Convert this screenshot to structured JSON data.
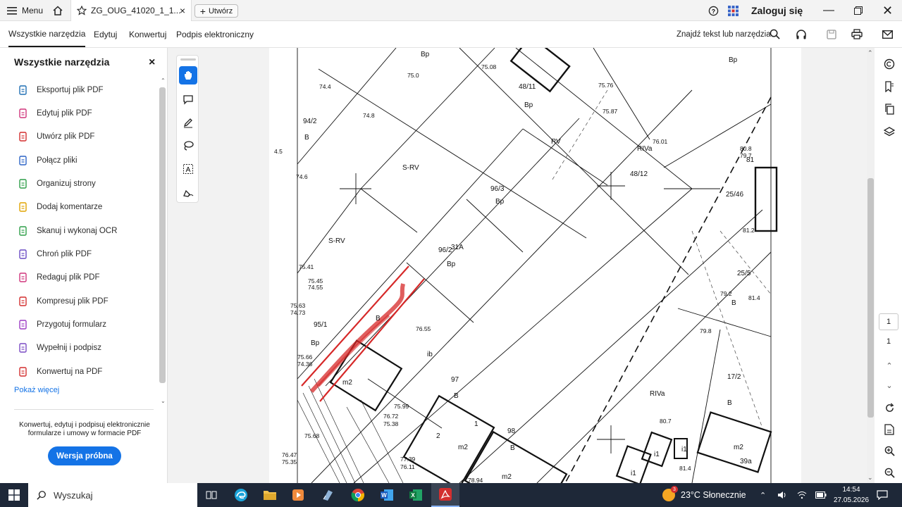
{
  "browser": {
    "menu_label": "Menu",
    "tab_title": "ZG_OUG_41020_1_1...",
    "new_tab_label": "Utwórz",
    "signin_label": "Zaloguj się"
  },
  "toolbar": {
    "menus": [
      "Wszystkie narzędzia",
      "Edytuj",
      "Konwertuj",
      "Podpis elektroniczny"
    ],
    "search_label": "Znajdź tekst lub narzędzia"
  },
  "panel": {
    "title": "Wszystkie narzędzia",
    "tools": [
      {
        "label": "Eksportuj plik PDF",
        "icon": "export-pdf-icon",
        "color": "#1f6fb3"
      },
      {
        "label": "Edytuj plik PDF",
        "icon": "edit-pdf-icon",
        "color": "#d0357c"
      },
      {
        "label": "Utwórz plik PDF",
        "icon": "create-pdf-icon",
        "color": "#d32f2f"
      },
      {
        "label": "Połącz pliki",
        "icon": "combine-files-icon",
        "color": "#2c64c6"
      },
      {
        "label": "Organizuj strony",
        "icon": "organize-pages-icon",
        "color": "#2e9e48"
      },
      {
        "label": "Dodaj komentarze",
        "icon": "comment-icon",
        "color": "#e0a400"
      },
      {
        "label": "Skanuj i wykonaj OCR",
        "icon": "scan-ocr-icon",
        "color": "#2e9e48"
      },
      {
        "label": "Chroń plik PDF",
        "icon": "protect-icon",
        "color": "#6a4bc4"
      },
      {
        "label": "Redaguj plik PDF",
        "icon": "redact-icon",
        "color": "#d0357c"
      },
      {
        "label": "Kompresuj plik PDF",
        "icon": "compress-icon",
        "color": "#d32f2f"
      },
      {
        "label": "Przygotuj formularz",
        "icon": "prepare-form-icon",
        "color": "#9c3cc4"
      },
      {
        "label": "Wypełnij i podpisz",
        "icon": "fill-sign-icon",
        "color": "#7a4bc4"
      },
      {
        "label": "Konwertuj na PDF",
        "icon": "convert-pdf-icon",
        "color": "#d32f2f"
      }
    ],
    "show_more": "Pokaż więcej",
    "promo_text": "Konwertuj, edytuj i podpisuj elektronicznie formularze i umowy w formacie PDF",
    "trial_button": "Wersja próbna"
  },
  "page_nav": {
    "current": "1",
    "total": "1"
  },
  "map": {
    "labels": [
      "Bp",
      "74.4",
      "75.0",
      "75.08",
      "48/11",
      "Bp",
      "75.76",
      "75.87",
      "Bp",
      "94/2",
      "B",
      "74.8",
      "RV",
      "76.01",
      "RIVa",
      "80.8",
      "79.7",
      "81",
      "4.5",
      "S-RV",
      "96/3",
      "Bp",
      "48/12",
      "25/46",
      "74.6",
      "81.2",
      "S-RV",
      "96/2",
      "31A",
      "Bp",
      "25/5",
      "75.41",
      "75.45",
      "74.55",
      "79.2",
      "B",
      "81.4",
      "75.63",
      "74.73",
      "95/1",
      "B",
      "76.55",
      "79.8",
      "Bp",
      "ib",
      "75.66",
      "74.36",
      "m2",
      "97",
      "B",
      "17/2",
      "RIVa",
      "B",
      "75.99",
      "76.72",
      "75.38",
      "1",
      "98",
      "B",
      "80.7",
      "2",
      "m2",
      "i1",
      "i1",
      "m2",
      "39a",
      "75.68",
      "76.47",
      "75.35",
      "77.39",
      "76.11",
      "78.94",
      "m2",
      "i1",
      "81.4"
    ]
  },
  "taskbar": {
    "search_placeholder": "Wyszukaj",
    "weather": "23°C  Słonecznie",
    "time": "14:54",
    "date": "27.05.2026",
    "weather_badge": "3"
  }
}
